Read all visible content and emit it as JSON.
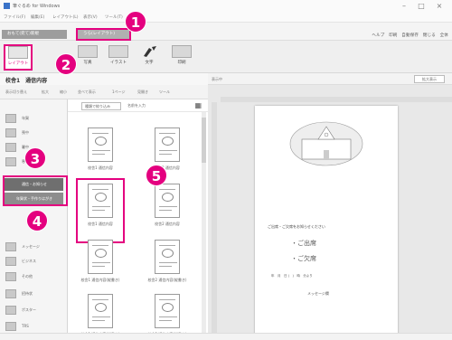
{
  "window": {
    "title": "筆ぐるめ for Windows",
    "controls": [
      "–",
      "□",
      "×"
    ]
  },
  "menubar": {
    "items": [
      "ファイル(F)",
      "編集(E)",
      "レイアウト(L)",
      "表示(V)",
      "ツール(T)",
      "ヘルプ(H)"
    ]
  },
  "tabs": {
    "new_label": "おもて(宛て)新規",
    "open_label": "うら(レイアウト)"
  },
  "toolbar_right": "ヘルプ　印刷　自動保存　閉じる　全体",
  "ribbon": {
    "buttons": [
      "レイアウト",
      "写真",
      "イラスト",
      "文字",
      "印刷"
    ]
  },
  "document": {
    "title": "校舎1　通信内容"
  },
  "subbar": {
    "items": [
      "表示切り替え",
      "拡大",
      "縮小",
      "並べて表示",
      "1ページ",
      "見開き",
      "ツール"
    ]
  },
  "sidebar": {
    "categories": [
      "年賀",
      "喪中",
      "暑中",
      "寒中",
      "通信・お知らせ",
      "年賀・手作りはがき",
      "メッセージ",
      "ビジネス",
      "その他",
      "招待状",
      "ポスター",
      "TRS"
    ],
    "selected_index": 4,
    "sub_selected": "年賀状・手作りはがき"
  },
  "gallery": {
    "select_value": "種類で絞り込み",
    "filter_label": "名前を入力",
    "view_icon": "grid-icon",
    "thumbnails": [
      "校舎1 通信内容",
      "校舎2 通信内容",
      "校舎1 通信内容",
      "校舎2 通信内容",
      "校舎1 通信内容(縦書き)",
      "校舎2 通信内容(縦書き)",
      "校舎1 通信内容(縦書き)",
      "校舎2 通信内容(縦書き)"
    ],
    "selected_index": 2
  },
  "preview": {
    "label": "表示中",
    "button": "拡大表示",
    "greeting": "ご出席・ご欠席をお知らせください",
    "attend_label": "・ご出席",
    "absent_label": "・ご欠席",
    "row_text": "年　月　日 (　)　時　分より",
    "message_label": "メッセージ欄"
  },
  "callouts": [
    "1",
    "2",
    "3",
    "4",
    "5"
  ],
  "colors": {
    "accent": "#e4007f",
    "tab_gray": "#9d9d9d",
    "selected_gray": "#6f6f6f"
  }
}
